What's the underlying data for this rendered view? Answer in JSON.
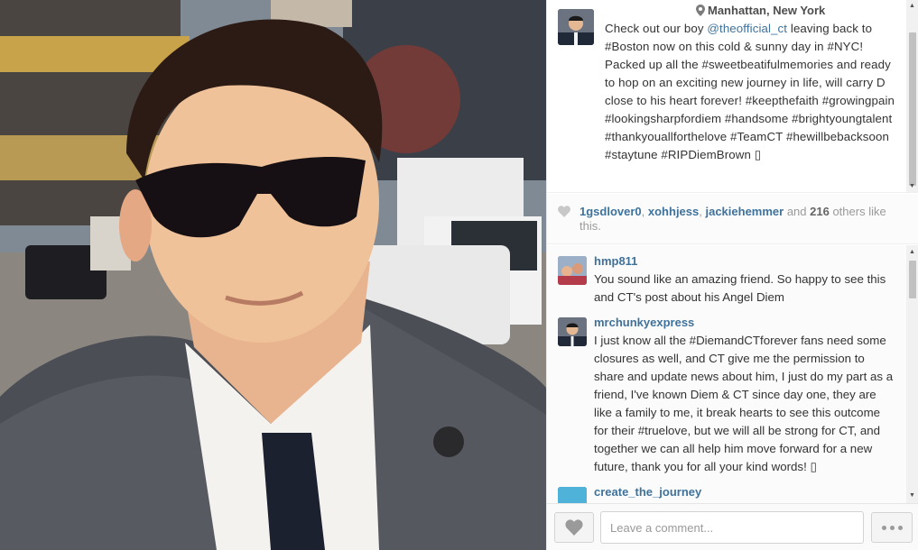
{
  "post": {
    "location": "Manhattan, New York",
    "caption_parts": {
      "before_mention": "Check out our boy ",
      "mention": "@theofficial_ct",
      "after_mention": " leaving back to #Boston now on this cold & sunny day in #NYC! Packed up all the #sweetbeatifulmemories and ready to hop on an exciting new journey in life, will carry D close to his heart forever! #keepthefaith #growingpain #lookingsharpfordiem #handsome #brightyoungtalent #thankyouallforthelove #TeamCT #hewillbebacksoon #staytune #RIPDiemBrown ▯"
    }
  },
  "likes": {
    "user1": "1gsdlover0",
    "sep1": ", ",
    "user2": "xohhjess",
    "sep2": ", ",
    "user3": "jackiehemmer",
    "and_text": " and ",
    "count": "216",
    "suffix": " others like this."
  },
  "comments": [
    {
      "user": "hmp811",
      "text": "You sound like an amazing friend. So happy to see this and CT's post about his Angel Diem"
    },
    {
      "user": "mrchunkyexpress",
      "text": "I just know all the #DiemandCTforever fans need some closures as well, and CT give me the permission to share and update news about him, I just do my part as a friend, I've known Diem & CT since day one, they are like a family to me, it break hearts to see this outcome for their #truelove, but we will all be strong for CT, and together we can all help him move forward for a new future, thank you for all your kind words! ▯"
    },
    {
      "user": "create_the_journey",
      "text": ""
    }
  ],
  "footer": {
    "comment_placeholder": "Leave a comment..."
  },
  "icons": {
    "location": "location-pin-icon",
    "like": "heart-icon",
    "more": "more-options-icon"
  },
  "colors": {
    "link": "#3f729b",
    "text": "#333333",
    "muted": "#9a9a9a"
  }
}
